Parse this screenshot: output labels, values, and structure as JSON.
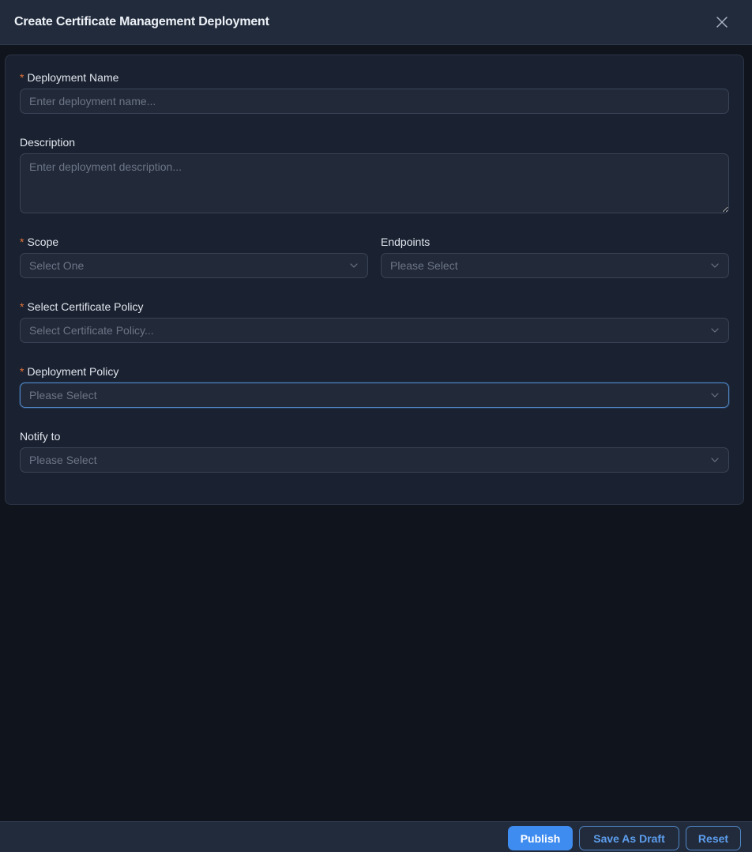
{
  "dialog": {
    "title": "Create Certificate Management Deployment"
  },
  "form": {
    "deployment_name": {
      "label": "Deployment Name",
      "required_mark": "*",
      "placeholder": "Enter deployment name..."
    },
    "description": {
      "label": "Description",
      "placeholder": "Enter deployment description..."
    },
    "scope": {
      "label": "Scope",
      "required_mark": "*",
      "placeholder": "Select One"
    },
    "endpoints": {
      "label": "Endpoints",
      "placeholder": "Please Select"
    },
    "certificate_policy": {
      "label": "Select Certificate Policy",
      "required_mark": "*",
      "placeholder": "Select Certificate Policy..."
    },
    "deployment_policy": {
      "label": "Deployment Policy",
      "required_mark": "*",
      "placeholder": "Please Select"
    },
    "notify_to": {
      "label": "Notify to",
      "placeholder": "Please Select"
    }
  },
  "footer": {
    "publish_label": "Publish",
    "save_draft_label": "Save As Draft",
    "reset_label": "Reset"
  },
  "icons": {
    "close": "close-icon",
    "dropdown": "chevron-down-icon"
  },
  "colors": {
    "background": "#10141d",
    "header": "#222b3b",
    "card": "#1a2130",
    "required": "#e0723a",
    "accent": "#3f8cf0",
    "focus_border": "#4f86c6"
  }
}
